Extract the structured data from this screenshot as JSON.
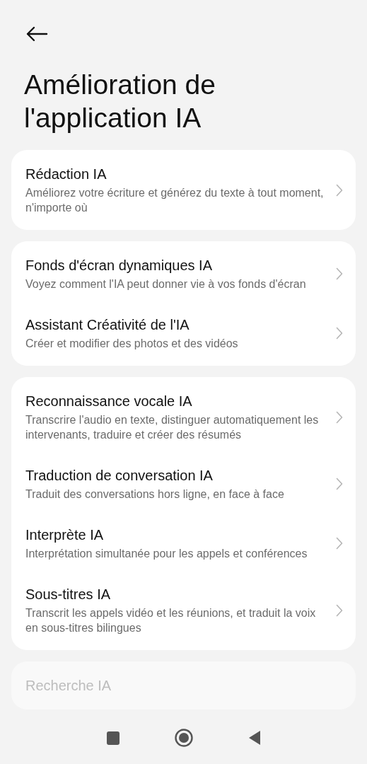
{
  "page": {
    "title": "Amélioration de l'application IA"
  },
  "groups": [
    {
      "items": [
        {
          "title": "Rédaction IA",
          "subtitle": "Améliorez votre écriture et générez du texte à tout moment, n'importe où"
        }
      ]
    },
    {
      "items": [
        {
          "title": "Fonds d'écran dynamiques IA",
          "subtitle": "Voyez comment l'IA peut donner vie à vos fonds d'écran"
        },
        {
          "title": "Assistant Créativité de l'IA",
          "subtitle": "Créer et modifier des photos et des vidéos"
        }
      ]
    },
    {
      "items": [
        {
          "title": "Reconnaissance vocale IA",
          "subtitle": "Transcrire l'audio en texte, distinguer automatiquement les intervenants, traduire et créer des résumés"
        },
        {
          "title": "Traduction de conversation IA",
          "subtitle": "Traduit des conversations hors ligne, en face à face"
        },
        {
          "title": "Interprète IA",
          "subtitle": "Interprétation simultanée pour les appels et conférences"
        },
        {
          "title": "Sous-titres IA",
          "subtitle": "Transcrit les appels vidéo et les réunions, et traduit la voix en sous-titres bilingues"
        }
      ]
    },
    {
      "faded": true,
      "items": [
        {
          "title": "Recherche IA"
        }
      ]
    }
  ]
}
